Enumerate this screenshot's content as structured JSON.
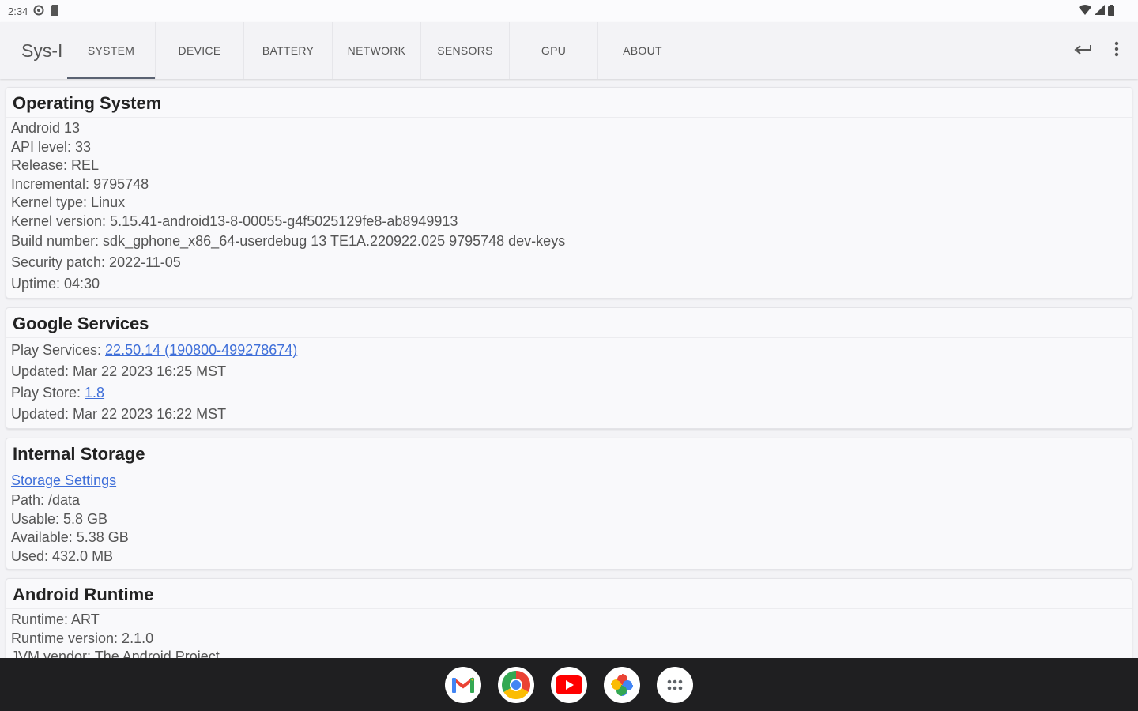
{
  "status_bar": {
    "time": "2:34"
  },
  "app_bar": {
    "title": "Sys-I",
    "tabs": [
      {
        "label": "SYSTEM"
      },
      {
        "label": "DEVICE"
      },
      {
        "label": "BATTERY"
      },
      {
        "label": "NETWORK"
      },
      {
        "label": "SENSORS"
      },
      {
        "label": "GPU"
      },
      {
        "label": "ABOUT"
      }
    ]
  },
  "os": {
    "title": "Operating System",
    "rows": [
      "Android 13",
      "API level: 33",
      "Release: REL",
      "Incremental: 9795748",
      "Kernel type: Linux",
      "Kernel version: 5.15.41-android13-8-00055-g4f5025129fe8-ab8949913",
      "Build number: sdk_gphone_x86_64-userdebug 13 TE1A.220922.025 9795748 dev-keys",
      "Security patch: 2022-11-05",
      "Uptime: 04:30"
    ]
  },
  "gservices": {
    "title": "Google Services",
    "play_services_label": "Play Services: ",
    "play_services_value": "22.50.14 (190800-499278674)",
    "play_services_updated": "Updated: Mar 22 2023 16:25 MST",
    "play_store_label": "Play Store: ",
    "play_store_value": "1.8",
    "play_store_updated": "Updated: Mar 22 2023 16:22 MST"
  },
  "storage": {
    "title": "Internal Storage",
    "settings_link": "Storage Settings",
    "rows": [
      "Path: /data",
      "Usable: 5.8 GB",
      "Available: 5.38 GB",
      "Used: 432.0 MB"
    ]
  },
  "runtime": {
    "title": "Android Runtime",
    "rows": [
      "Runtime: ART",
      "Runtime version: 2.1.0",
      "JVM vendor: The Android Project"
    ]
  },
  "dock": {
    "apps": [
      "gmail-icon",
      "chrome-icon",
      "youtube-icon",
      "photos-icon",
      "app-drawer-icon"
    ]
  },
  "colors": {
    "link": "#3f6fd9",
    "dock_bg": "#1f1f21",
    "tab_indicator": "#5a6272"
  }
}
